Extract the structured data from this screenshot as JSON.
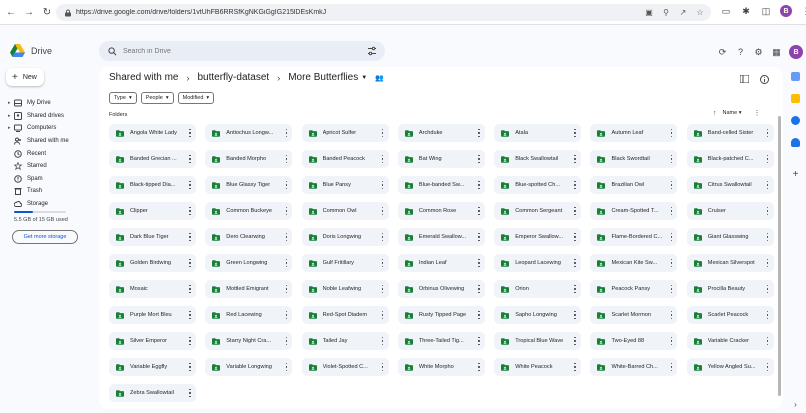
{
  "browser": {
    "url": "https://drive.google.com/drive/folders/1vtUhFB6RRSfKgNKGiGgIG215lDEsKmkJ",
    "profile_initial": "B"
  },
  "app": {
    "name": "Drive",
    "search_placeholder": "Search in Drive",
    "profile_initial": "B"
  },
  "new_button": "New",
  "nav": [
    {
      "label": "My Drive",
      "icon": "my-drive-icon",
      "caret": true
    },
    {
      "label": "Shared drives",
      "icon": "shared-drives-icon",
      "caret": true
    },
    {
      "label": "Computers",
      "icon": "computers-icon",
      "caret": true
    },
    {
      "label": "Shared with me",
      "icon": "shared-with-me-icon",
      "caret": false
    },
    {
      "label": "Recent",
      "icon": "recent-icon",
      "caret": false
    },
    {
      "label": "Starred",
      "icon": "starred-icon",
      "caret": false
    },
    {
      "label": "Spam",
      "icon": "spam-icon",
      "caret": false
    },
    {
      "label": "Trash",
      "icon": "trash-icon",
      "caret": false
    },
    {
      "label": "Storage",
      "icon": "storage-icon",
      "caret": false
    }
  ],
  "storage": {
    "text": "5.5 GB of 15 GB used",
    "used_fraction": 0.37,
    "button": "Get more storage"
  },
  "breadcrumb": {
    "items": [
      "Shared with me",
      "butterfly-dataset"
    ],
    "current": "More Butterflies"
  },
  "filters": [
    "Type",
    "People",
    "Modified"
  ],
  "folders_label": "Folders",
  "sort_label": "Name",
  "folders": [
    "Angola White Lady",
    "Antiochus Longw...",
    "Apricot Sulfer",
    "Archduke",
    "Atala",
    "Autumn Leaf",
    "Band-celled Sister",
    "Banded Grecian ...",
    "Banded Morpho",
    "Banded Peacock",
    "Bat Wing",
    "Black Swallowtail",
    "Black Swordtail",
    "Black-patched C...",
    "Black-tipped Dia...",
    "Blue Glassy Tiger",
    "Blue Pansy",
    "Blue-banded Sw...",
    "Blue-spotted Ch...",
    "Brazilian Owl",
    "Citrus Swallowtail",
    "Clipper",
    "Common Buckeye",
    "Common Owl",
    "Common Rose",
    "Common Sergeant",
    "Cream-Spotted T...",
    "Cruiser",
    "Dark Blue Tiger",
    "Dero Clearwing",
    "Doris Longwing",
    "Emerald Swallow...",
    "Emperor Swallow...",
    "Flame-Bordered C...",
    "Giant Glasswing",
    "Golden Birdwing",
    "Green Longwing",
    "Gulf Fritillary",
    "Indian Leaf",
    "Leopard Lacewing",
    "Mexican Kite Sw...",
    "Mexican Silverspot",
    "Mosaic",
    "Mottled Emigrant",
    "Noble Leafwing",
    "Orbinus Olivewing",
    "Orion",
    "Peacock Pansy",
    "Procilla Beauty",
    "Purple Mort Bleu",
    "Red Lacewing",
    "Red-Spot Diadem",
    "Rusty Tipped Page",
    "Sapho Longwing",
    "Scarlet Mormon",
    "Scarlet Peacock",
    "Silver Emperor",
    "Starry Night Cra...",
    "Tailed Jay",
    "Three-Tailed Tig...",
    "Tropical Blue Wave",
    "Two-Eyed 88",
    "Variable Cracker",
    "Variable Eggfly",
    "Variable Longwing",
    "Violet-Spotted C...",
    "White Morpho",
    "White Peacock",
    "White-Barred Ch...",
    "Yellow Angled Su...",
    "Zebra Swallowtail"
  ],
  "colors": {
    "folder_icon": "#188038",
    "accent": "#0b57d0",
    "profile": "#8e44ad",
    "tile": "#f0f4f9"
  }
}
